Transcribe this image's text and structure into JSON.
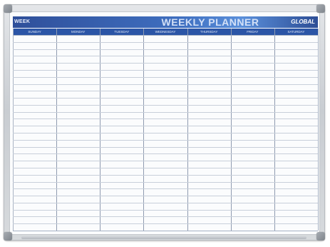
{
  "planner": {
    "title": "WEEKLY PLANNER",
    "week_label": "WEEK",
    "logo": "GLOBAL",
    "days": [
      "SUNDAY",
      "MONDAY",
      "TUESDAY",
      "WEDNESDAY",
      "THURSDAY",
      "FRIDAY",
      "SATURDAY"
    ],
    "colors": {
      "header_blue": "#2f4f9a",
      "header_light_blue": "#5a8fda",
      "day_row_blue": "#2b55a6",
      "grid_line": "#c8cfda",
      "frame": "#c9cdd2"
    }
  }
}
